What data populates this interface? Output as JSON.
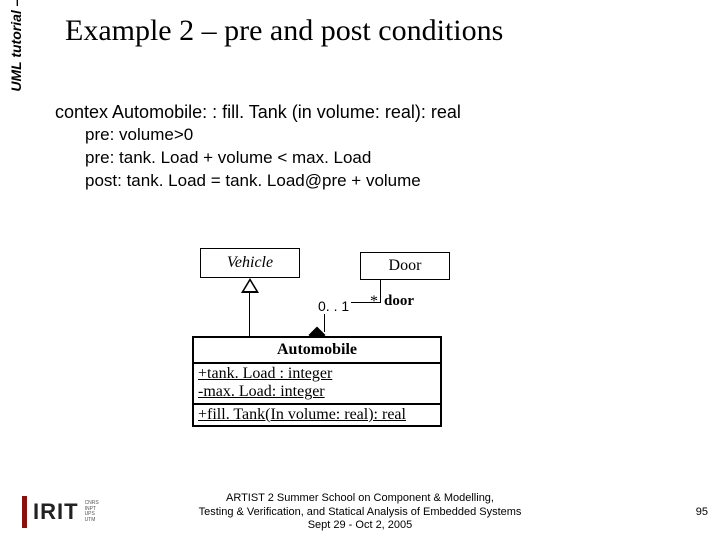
{
  "meta": {
    "sidebar": "UML tutorial – Ileana Ober",
    "title": "Example 2 – pre and post conditions",
    "page_number": "95"
  },
  "code": {
    "context": "contex Automobile: : fill. Tank (in volume: real): real",
    "pre1": "pre: volume>0",
    "pre2": "pre: tank. Load + volume < max. Load",
    "post": "post: tank. Load = tank. Load@pre + volume"
  },
  "diagram": {
    "vehicle": "Vehicle",
    "door": "Door",
    "mult_src": "0. . 1",
    "mult_dst": "*",
    "role": "door",
    "automobile": {
      "name": "Automobile",
      "attr1": "+tank. Load : integer",
      "attr2": "-max. Load: integer",
      "op1": "+fill. Tank(In volume: real): real"
    }
  },
  "footer": {
    "line1": "ARTIST 2 Summer School on Component & Modelling,",
    "line2": "Testing & Verification, and Statical Analysis of Embedded Systems",
    "line3": "Sept 29 - Oct 2, 2005"
  },
  "logo": {
    "text": "IRIT",
    "affil1": "CNRS",
    "affil2": "INPT",
    "affil3": "UPS",
    "affil4": "UTM"
  }
}
